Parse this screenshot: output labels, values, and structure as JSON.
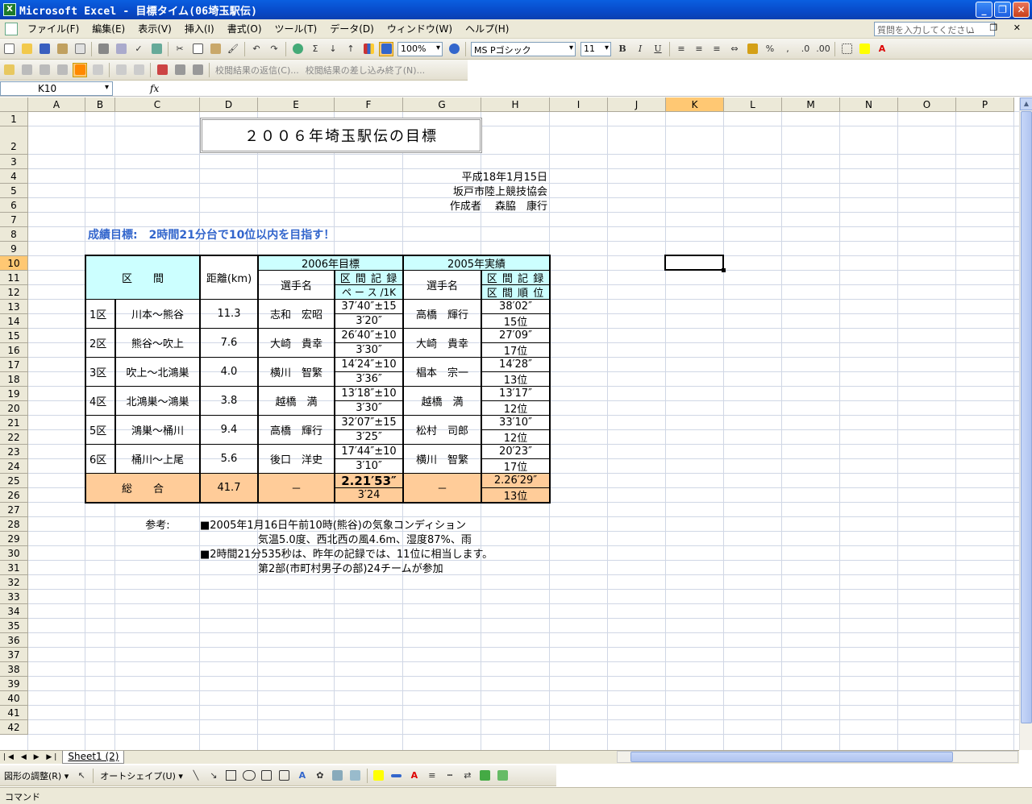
{
  "window": {
    "title": "Microsoft Excel - 目標タイム(06埼玉駅伝)",
    "min": "_",
    "restore": "❐",
    "close": "✕"
  },
  "menu": {
    "items": [
      "ファイル(F)",
      "編集(E)",
      "表示(V)",
      "挿入(I)",
      "書式(O)",
      "ツール(T)",
      "データ(D)",
      "ウィンドウ(W)",
      "ヘルプ(H)"
    ],
    "help_placeholder": "質問を入力してください",
    "mdi": "_ ❐ ✕"
  },
  "toolbar": {
    "zoom": "100%",
    "font": "MS Pゴシック",
    "size": "11",
    "bold": "B",
    "italic": "I",
    "underline": "U",
    "percent": "%",
    "comma": ",",
    "sigma": "Σ"
  },
  "review_toolbar": {
    "reply": "校閲結果の返信(C)...",
    "end": "校閲結果の差し込み終了(N)..."
  },
  "formula": {
    "namebox": "K10",
    "fx": "fx",
    "content": ""
  },
  "columns": [
    "A",
    "B",
    "C",
    "D",
    "E",
    "F",
    "G",
    "H",
    "I",
    "J",
    "K",
    "L",
    "M",
    "N",
    "O",
    "P"
  ],
  "rows": [
    "1",
    "2",
    "3",
    "4",
    "5",
    "6",
    "7",
    "8",
    "9",
    "10",
    "11",
    "12",
    "13",
    "14",
    "15",
    "16",
    "17",
    "18",
    "19",
    "20",
    "21",
    "22",
    "23",
    "24",
    "25",
    "26",
    "27",
    "28",
    "29",
    "30",
    "31",
    "32",
    "33",
    "34",
    "35",
    "36",
    "37",
    "38",
    "39",
    "40",
    "41",
    "42"
  ],
  "sheet": {
    "title": "２００６年埼玉駅伝の目標",
    "date": "平成18年1月15日",
    "org": "坂戸市陸上競技協会",
    "author": "作成者　 森脇　康行",
    "goal": "成績目標:　2時間21分台で10位以内を目指す！",
    "h_section": "区　　間",
    "h_distance": "距離(km)",
    "h_target": "2006年目標",
    "h_actual": "2005年実績",
    "h_runner": "選手名",
    "h_record": "区 間 記 録",
    "h_pace": "ペ ー ス /1K",
    "h_runner2": "選手名",
    "h_record2": "区 間 記 録",
    "h_rank": "区 間 順 位",
    "legs": [
      {
        "no": "1区",
        "name": "川本～熊谷",
        "dist": "11.3",
        "runner": "志和　宏昭",
        "target": "37′40″±15",
        "pace": "3′20″",
        "runner05": "高橋　輝行",
        "time05": "38′02″",
        "rank05": "15位"
      },
      {
        "no": "2区",
        "name": "熊谷～吹上",
        "dist": "7.6",
        "runner": "大崎　貴幸",
        "target": "26′40″±10",
        "pace": "3′30″",
        "runner05": "大崎　貴幸",
        "time05": "27′09″",
        "rank05": "17位"
      },
      {
        "no": "3区",
        "name": "吹上～北鴻巣",
        "dist": "4.0",
        "runner": "横川　智繁",
        "target": "14′24″±10",
        "pace": "3′36″",
        "runner05": "椙本　宗一",
        "time05": "14′28″",
        "rank05": "13位"
      },
      {
        "no": "4区",
        "name": "北鴻巣～鴻巣",
        "dist": "3.8",
        "runner": "越橋　満",
        "target": "13′18″±10",
        "pace": "3′30″",
        "runner05": "越橋　満",
        "time05": "13′17″",
        "rank05": "12位"
      },
      {
        "no": "5区",
        "name": "鴻巣～桶川",
        "dist": "9.4",
        "runner": "高橋　輝行",
        "target": "32′07″±15",
        "pace": "3′25″",
        "runner05": "松村　司郎",
        "time05": "33′10″",
        "rank05": "12位"
      },
      {
        "no": "6区",
        "name": "桶川～上尾",
        "dist": "5.6",
        "runner": "後口　洋史",
        "target": "17′44″±10",
        "pace": "3′10″",
        "runner05": "横川　智繁",
        "time05": "20′23″",
        "rank05": "17位"
      }
    ],
    "total": {
      "label": "総　　合",
      "dist": "41.7",
      "runner": "－",
      "target": "2.21′53″",
      "pace": "3′24",
      "runner05": "－",
      "time05": "2.26′29″",
      "rank05": "13位"
    },
    "ref_label": "参考:",
    "notes": [
      "■2005年1月16日午前10時(熊谷)の気象コンディション",
      "気温5.0度、西北西の風4.6m、湿度87%、雨",
      "■2時間21分535秒は、昨年の記録では、11位に相当します。",
      "第2部(市町村男子の部)24チームが参加"
    ]
  },
  "tabs": {
    "nav": "|◀ ◀ ▶ ▶|",
    "sheet1": "Sheet1 (2)"
  },
  "drawing": {
    "shapes": "図形の調整(R) ▾",
    "autoshape": "オートシェイプ(U) ▾"
  },
  "status": "コマンド",
  "colors": {
    "header_fill": "#ccffff",
    "total_fill": "#ffcc99",
    "goal_text": "#3366cc",
    "selection": "#ffc873"
  }
}
